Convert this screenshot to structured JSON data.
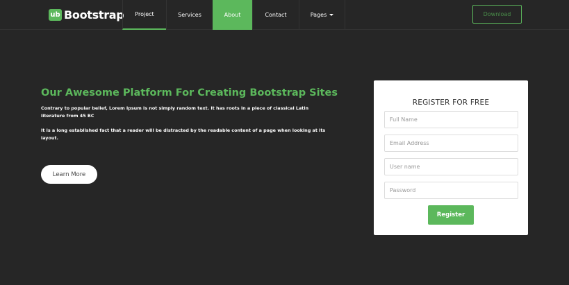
{
  "nav": {
    "brand_badge": "ub",
    "brand_name": "Bootstrap",
    "items": [
      {
        "label": "Project"
      },
      {
        "label": "Services"
      },
      {
        "label": "About"
      },
      {
        "label": "Contact"
      },
      {
        "label": "Pages"
      }
    ],
    "download_label": "Download",
    "active_item": "About",
    "underlined_item": "Project"
  },
  "hero": {
    "title": "Our Awesome Platform For Creating Bootstrap Sites",
    "paragraph1": "Contrary to popular belief, Lorem Ipsum is not simply random text. It has roots in a piece of classical Latin literature from 45 BC",
    "paragraph2": "It is a long established fact that a reader will be distracted by the readable content of a page when looking at its layout.",
    "button_label": "Learn More"
  },
  "register": {
    "title": "REGISTER FOR FREE",
    "fields": [
      {
        "placeholder": "Full Name",
        "value": ""
      },
      {
        "placeholder": "Email Address",
        "value": ""
      },
      {
        "placeholder": "User name",
        "value": ""
      },
      {
        "placeholder": "Password",
        "value": ""
      }
    ],
    "button_label": "Register"
  },
  "colors": {
    "background": "#262626",
    "accent": "#5cb85c",
    "card": "#ffffff"
  }
}
